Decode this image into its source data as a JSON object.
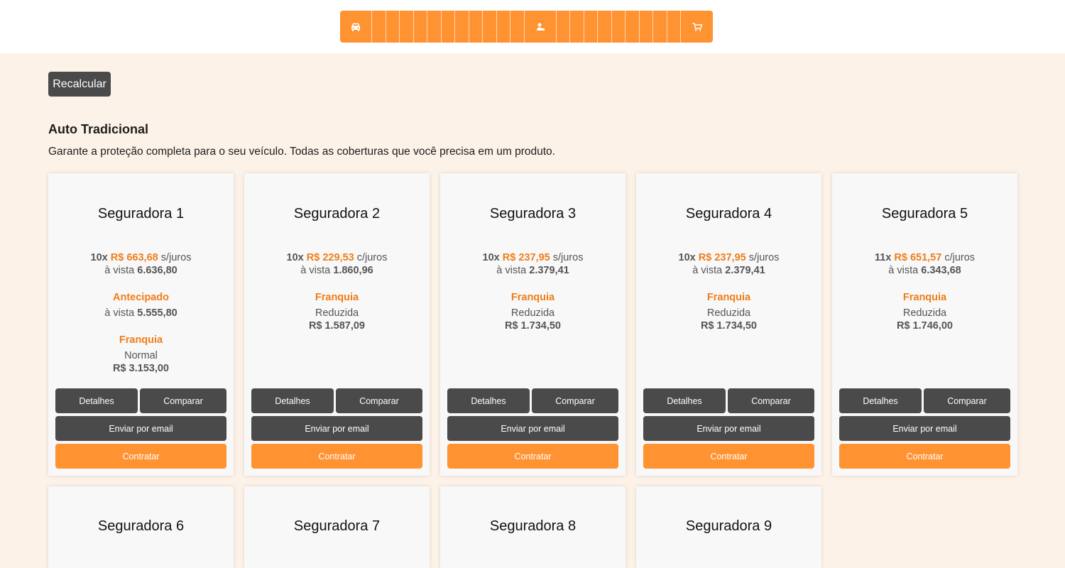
{
  "stepper": {
    "first_icon": "car-icon",
    "middle_icon": "person-icon",
    "last_icon": "cart-icon",
    "color": "#ff9231"
  },
  "recalc_label": "Recalcular",
  "section": {
    "title": "Auto Tradicional",
    "description": "Garante a proteção completa para o seu veículo. Todas as coberturas que você precisa em um produto."
  },
  "labels": {
    "details": "Detalhes",
    "compare": "Comparar",
    "email": "Enviar por email",
    "contract": "Contratar",
    "a_vista": "à vista"
  },
  "cards": [
    {
      "name": "Seguradora 1",
      "installments": "10x",
      "installment_value": "R$ 663,68",
      "interest": "s/juros",
      "cash_price": "6.636,80",
      "antecipado_label": "Antecipado",
      "antecipado_price": "5.555,80",
      "franquia_label": "Franquia",
      "franquia_type": "Normal",
      "franquia_value": "R$ 3.153,00"
    },
    {
      "name": "Seguradora 2",
      "installments": "10x",
      "installment_value": "R$ 229,53",
      "interest": "c/juros",
      "cash_price": "1.860,96",
      "franquia_label": "Franquia",
      "franquia_type": "Reduzida",
      "franquia_value": "R$ 1.587,09"
    },
    {
      "name": "Seguradora 3",
      "installments": "10x",
      "installment_value": "R$ 237,95",
      "interest": "s/juros",
      "cash_price": "2.379,41",
      "franquia_label": "Franquia",
      "franquia_type": "Reduzida",
      "franquia_value": "R$ 1.734,50"
    },
    {
      "name": "Seguradora 4",
      "installments": "10x",
      "installment_value": "R$ 237,95",
      "interest": "s/juros",
      "cash_price": "2.379,41",
      "franquia_label": "Franquia",
      "franquia_type": "Reduzida",
      "franquia_value": "R$ 1.734,50"
    },
    {
      "name": "Seguradora 5",
      "installments": "11x",
      "installment_value": "R$ 651,57",
      "interest": "c/juros",
      "cash_price": "6.343,68",
      "franquia_label": "Franquia",
      "franquia_type": "Reduzida",
      "franquia_value": "R$ 1.746,00"
    },
    {
      "name": "Seguradora 6"
    },
    {
      "name": "Seguradora 7"
    },
    {
      "name": "Seguradora 8"
    },
    {
      "name": "Seguradora 9"
    }
  ]
}
